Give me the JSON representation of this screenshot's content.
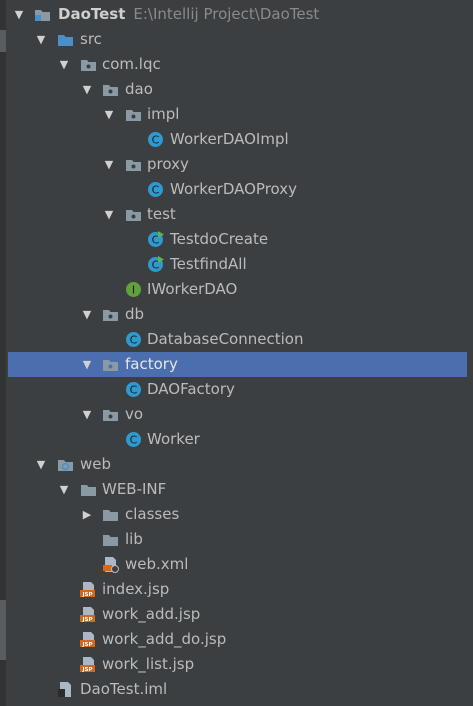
{
  "project": {
    "name": "DaoTest",
    "path": "E:\\Intellij Project\\DaoTest"
  },
  "nodes": {
    "src": "src",
    "pkg_root": "com.lqc",
    "dao": "dao",
    "impl": "impl",
    "worker_dao_impl": "WorkerDAOImpl",
    "proxy": "proxy",
    "worker_dao_proxy": "WorkerDAOProxy",
    "test": "test",
    "testdo_create": "TestdoCreate",
    "testfind_all": "TestfindAll",
    "iworker_dao": "IWorkerDAO",
    "db": "db",
    "database_connection": "DatabaseConnection",
    "factory": "factory",
    "dao_factory": "DAOFactory",
    "vo": "vo",
    "worker": "Worker",
    "web": "web",
    "web_inf": "WEB-INF",
    "classes": "classes",
    "lib": "lib",
    "web_xml": "web.xml",
    "index_jsp": "index.jsp",
    "work_add_jsp": "work_add.jsp",
    "work_add_do_jsp": "work_add_do.jsp",
    "work_list_jsp": "work_list.jsp",
    "iml": "DaoTest.iml"
  },
  "icon_labels": {
    "class": "C",
    "interface": "I",
    "jsp": "JSP"
  },
  "colors": {
    "background": "#3c3f41",
    "selection": "#4b6eaf",
    "text": "#bbbbbb",
    "folder": "#8a9aa4",
    "source_folder": "#4a8fc7",
    "class_icon": "#2f9ad0",
    "interface_icon": "#62a03a",
    "jsp_icon": "#d2691e"
  }
}
